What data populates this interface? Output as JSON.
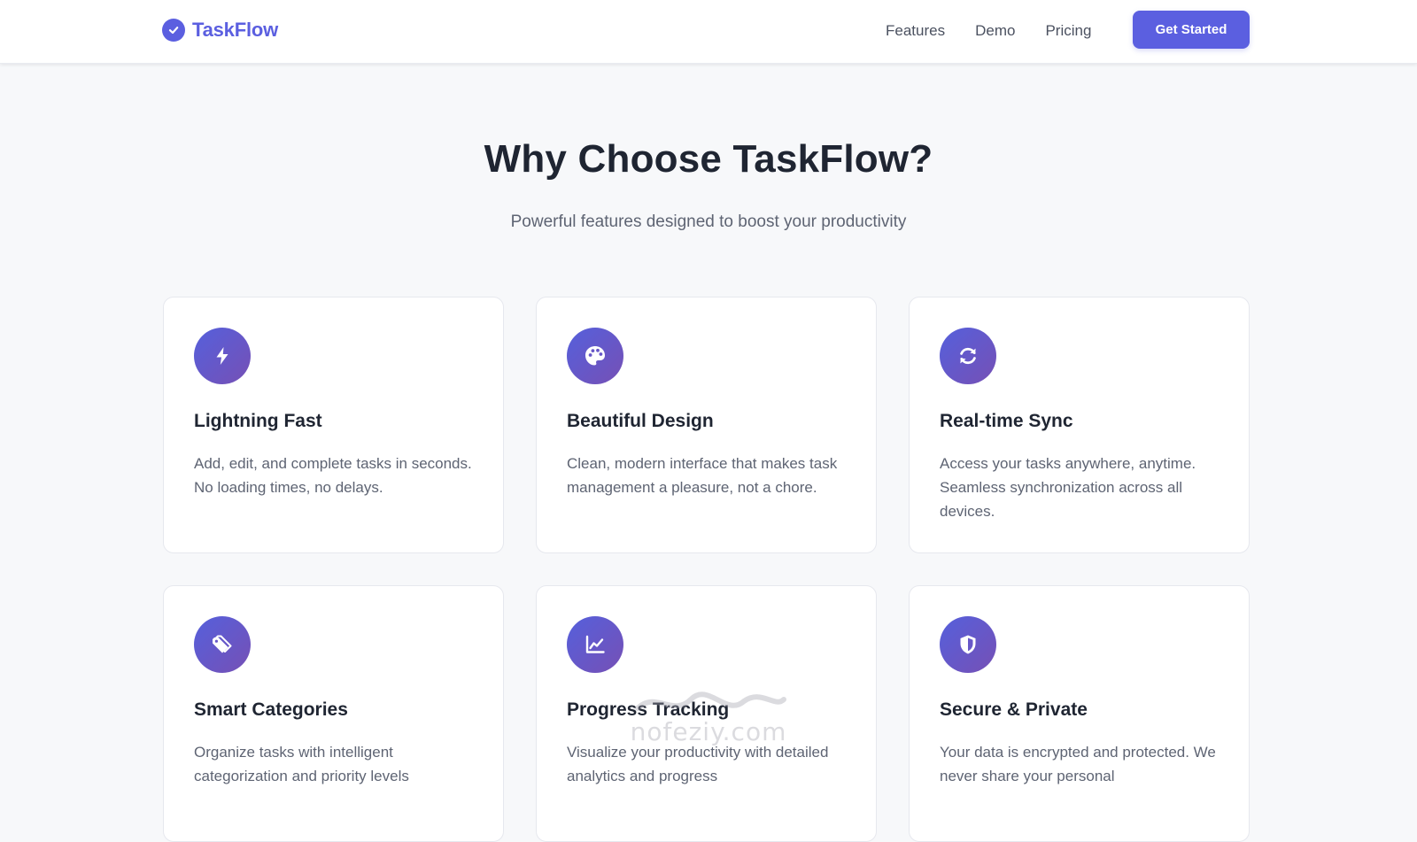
{
  "header": {
    "logo_text": "TaskFlow",
    "logo_icon": "check-circle-icon",
    "nav_links": [
      "Features",
      "Demo",
      "Pricing"
    ],
    "cta_label": "Get Started"
  },
  "section": {
    "title": "Why Choose TaskFlow?",
    "subtitle": "Powerful features designed to boost your productivity"
  },
  "features": [
    {
      "icon": "lightning-bolt-icon",
      "title": "Lightning Fast",
      "description": "Add, edit, and complete tasks in seconds. No loading times, no delays."
    },
    {
      "icon": "palette-icon",
      "title": "Beautiful Design",
      "description": "Clean, modern interface that makes task management a pleasure, not a chore."
    },
    {
      "icon": "sync-icon",
      "title": "Real-time Sync",
      "description": "Access your tasks anywhere, anytime. Seamless synchronization across all devices."
    },
    {
      "icon": "tags-icon",
      "title": "Smart Categories",
      "description": "Organize tasks with intelligent categorization and priority levels"
    },
    {
      "icon": "chart-line-icon",
      "title": "Progress Tracking",
      "description": "Visualize your productivity with detailed analytics and progress"
    },
    {
      "icon": "shield-icon",
      "title": "Secure & Private",
      "description": "Your data is encrypted and protected. We never share your personal"
    }
  ],
  "watermark": {
    "text": "nofeziy.com"
  },
  "colors": {
    "brand": "#5b5fe0",
    "icon_gradient_start": "#5560dc",
    "icon_gradient_end": "#7650b5",
    "heading": "#1f2532",
    "body_text": "#5e6473",
    "page_background": "#f7f8fa"
  }
}
